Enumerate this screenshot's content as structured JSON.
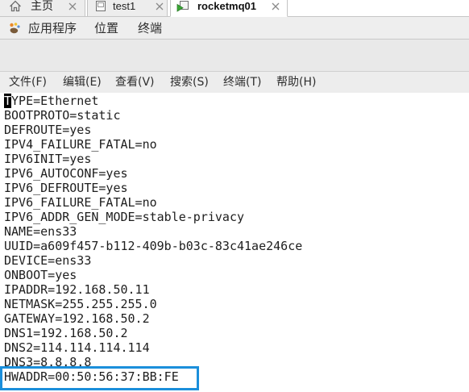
{
  "tabs": [
    {
      "label": "主页",
      "icon": "home-icon",
      "active": false
    },
    {
      "label": "test1",
      "icon": "virtual-machine-icon",
      "active": false
    },
    {
      "label": "rocketmq01",
      "icon": "running-virtual-machine-icon",
      "active": true
    }
  ],
  "tab_close_icon": "close-icon",
  "desktop_menu": [
    {
      "label": "应用程序",
      "icon": "applications-icon"
    },
    {
      "label": "位置"
    },
    {
      "label": "终端"
    }
  ],
  "terminal": {
    "menu": [
      {
        "label": "文件(F)"
      },
      {
        "label": "编辑(E)"
      },
      {
        "label": "查看(V)"
      },
      {
        "label": "搜索(S)"
      },
      {
        "label": "终端(T)"
      },
      {
        "label": "帮助(H)"
      }
    ],
    "lines": [
      {
        "text": "TYPE=Ethernet",
        "cursor_column": 1
      },
      {
        "text": "BOOTPROTO=static"
      },
      {
        "text": "DEFROUTE=yes"
      },
      {
        "text": "IPV4_FAILURE_FATAL=no"
      },
      {
        "text": "IPV6INIT=yes"
      },
      {
        "text": "IPV6_AUTOCONF=yes"
      },
      {
        "text": "IPV6_DEFROUTE=yes"
      },
      {
        "text": "IPV6_FAILURE_FATAL=no"
      },
      {
        "text": "IPV6_ADDR_GEN_MODE=stable-privacy"
      },
      {
        "text": "NAME=ens33"
      },
      {
        "text": "UUID=a609f457-b112-409b-b03c-83c41ae246ce"
      },
      {
        "text": "DEVICE=ens33"
      },
      {
        "text": "ONBOOT=yes"
      },
      {
        "text": "IPADDR=192.168.50.11"
      },
      {
        "text": "NETMASK=255.255.255.0"
      },
      {
        "text": "GATEWAY=192.168.50.2"
      },
      {
        "text": "DNS1=192.168.50.2"
      },
      {
        "text": "DNS2=114.114.114.114"
      },
      {
        "text": "DNS3=8.8.8.8"
      },
      {
        "text": "HWADDR=00:50:56:37:BB:FE",
        "highlighted": true
      }
    ]
  },
  "colors": {
    "highlight_border": "#1b8fdb",
    "running_vm_green": "#3aa635",
    "terminal_background": "#ffffff",
    "terminal_text": "#1e1e1e"
  }
}
